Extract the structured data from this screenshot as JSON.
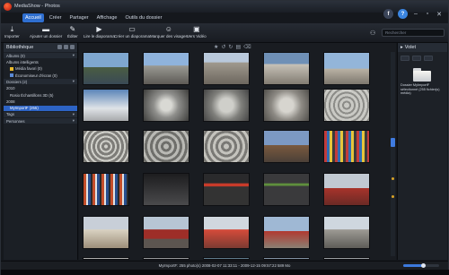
{
  "app": {
    "title": "MediaShow - Photos"
  },
  "menu": [
    "Accueil",
    "Créer",
    "Partager",
    "Affichage",
    "Outils du dossier"
  ],
  "toolbar": {
    "tools": [
      {
        "label": "Importer",
        "icon": "import-icon"
      },
      {
        "label": "Ajouter un dossier",
        "icon": "add-folder-icon"
      },
      {
        "label": "Éditer",
        "icon": "edit-icon"
      },
      {
        "label": "Lire le diaporama",
        "icon": "play-slideshow-icon"
      },
      {
        "label": "Créer un diaporama",
        "icon": "create-slideshow-icon"
      },
      {
        "label": "Marquer des visages",
        "icon": "tag-faces-icon"
      },
      {
        "label": "Vers Vidéo",
        "icon": "to-video-icon"
      }
    ],
    "search_placeholder": "Rechercher"
  },
  "left": {
    "title": "Bibliothèque",
    "rows": [
      {
        "text": "Albums (0)",
        "kind": "section"
      },
      {
        "text": "Albums intelligents",
        "kind": "plain"
      },
      {
        "text": "Média favori (0)",
        "kind": "sub"
      },
      {
        "text": "Économiseur d'écran (0)",
        "kind": "sub"
      },
      {
        "text": "Dossiers (2)",
        "kind": "section"
      },
      {
        "text": "2010",
        "kind": "plain"
      },
      {
        "text": "Rosio Échantillons 3D (5)",
        "kind": "sub"
      },
      {
        "text": "2008",
        "kind": "plain"
      },
      {
        "text": "MyImportF (255)",
        "kind": "selected"
      },
      {
        "text": "Tags",
        "kind": "section"
      },
      {
        "text": "Personnes",
        "kind": "section"
      }
    ]
  },
  "right": {
    "title": "Volet",
    "caption": "Dossier MyImportF sélectionné (255 fichier(s) média)"
  },
  "status": {
    "text": "MyImportF: 255 photo(s)  2008-02-07 11:33:11 - 2009-12-15 09:57:22  589 Mo"
  },
  "zoom_level": 0.55,
  "thumbnails_count": 30
}
